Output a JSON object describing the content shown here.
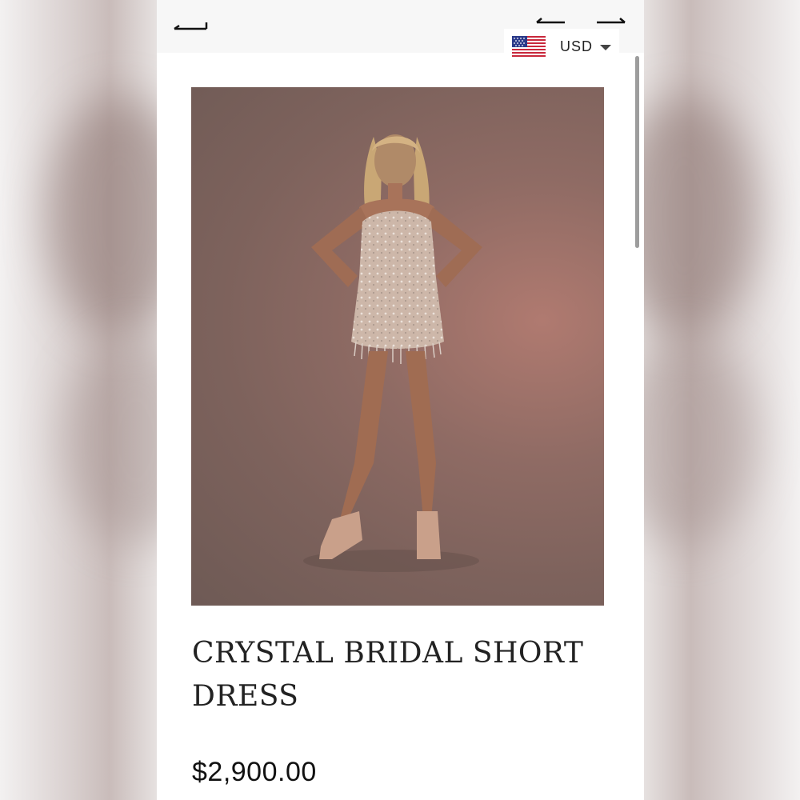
{
  "nav": {
    "back_icon": "arrow-left-icon",
    "prev_icon": "arrow-left-icon",
    "next_icon": "arrow-right-icon"
  },
  "currency": {
    "flag_icon": "us-flag-icon",
    "label": "USD",
    "dropdown_icon": "caret-down-icon"
  },
  "product": {
    "image_alt": "model-in-crystal-short-dress",
    "title": "CRYSTAL BRIDAL SHORT DRESS",
    "price": "$2,900.00"
  },
  "colors": {
    "background": "#ffffff",
    "text": "#222222",
    "photo_backdrop": "#8f6b64"
  }
}
